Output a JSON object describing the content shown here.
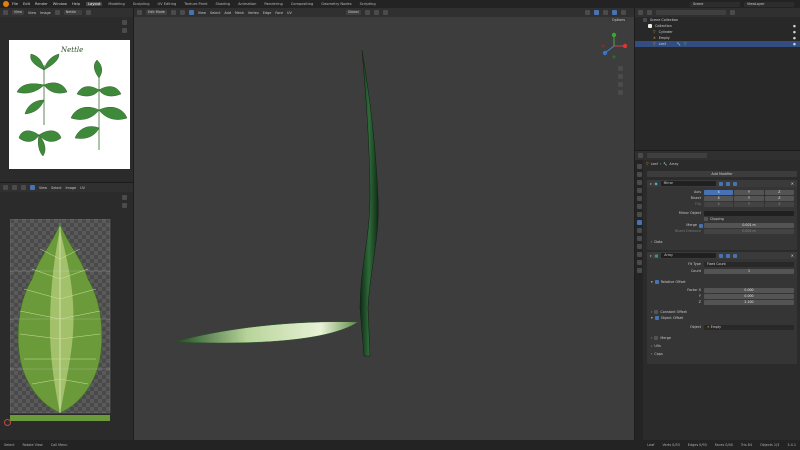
{
  "topbar": {
    "menus": [
      "File",
      "Edit",
      "Render",
      "Window",
      "Help"
    ],
    "workspaces": [
      {
        "label": "Layout",
        "active": true
      },
      {
        "label": "Modeling",
        "active": false
      },
      {
        "label": "Sculpting",
        "active": false
      },
      {
        "label": "UV Editing",
        "active": false
      },
      {
        "label": "Texture Paint",
        "active": false
      },
      {
        "label": "Shading",
        "active": false
      },
      {
        "label": "Animation",
        "active": false
      },
      {
        "label": "Rendering",
        "active": false
      },
      {
        "label": "Compositing",
        "active": false
      },
      {
        "label": "Geometry Nodes",
        "active": false
      },
      {
        "label": "Scripting",
        "active": false
      }
    ],
    "scene": "Scene",
    "view_layer": "ViewLayer"
  },
  "image_editor": {
    "header": [
      "View",
      "View",
      "Image"
    ],
    "image_name": "Nettle",
    "image_title": "Nettle"
  },
  "uv_editor": {
    "header": [
      "View",
      "Select",
      "Image",
      "UV"
    ]
  },
  "viewport": {
    "mode": "Edit Mode",
    "menus": [
      "View",
      "Select",
      "Add",
      "Mesh",
      "Vertex",
      "Edge",
      "Face",
      "UV"
    ],
    "transform": "Global",
    "options": "Options"
  },
  "outliner": {
    "items": [
      {
        "label": "Scene Collection",
        "indent": 0,
        "selected": false,
        "icon": "collection-icon"
      },
      {
        "label": "Collection",
        "indent": 1,
        "selected": false,
        "icon": "collection-icon"
      },
      {
        "label": "Cylinder",
        "indent": 2,
        "selected": false,
        "icon": "mesh-icon"
      },
      {
        "label": "Empty",
        "indent": 2,
        "selected": false,
        "icon": "empty-icon"
      },
      {
        "label": "Leaf",
        "indent": 2,
        "selected": true,
        "icon": "mesh-icon"
      }
    ]
  },
  "properties": {
    "breadcrumb": [
      "Leaf",
      "Array"
    ],
    "add_modifier": "Add Modifier",
    "mirror": {
      "name": "Mirror",
      "axis_label": "Axis",
      "bisect_label": "Bisect",
      "flip_label": "Flip",
      "axes": [
        "X",
        "Y",
        "Z"
      ],
      "mirror_object_label": "Mirror Object",
      "clipping_label": "Clipping",
      "merge_label": "Merge",
      "merge_value": "0.001 m",
      "bisect_distance_label": "Bisect Distance",
      "bisect_distance_value": "0.001 m",
      "data_label": "Data"
    },
    "array": {
      "name": "Array",
      "fit_type_label": "Fit Type",
      "fit_type_value": "Fixed Count",
      "count_label": "Count",
      "count_value": "1",
      "relative_offset_label": "Relative Offset",
      "factor_labels": [
        "Factor X",
        "Y",
        "Z"
      ],
      "factor_values": [
        "0.000",
        "0.000",
        "2.100"
      ],
      "constant_offset_label": "Constant Offset",
      "object_offset_label": "Object Offset",
      "object_label": "Object",
      "object_value": "Empty",
      "merge_label": "Merge",
      "uvs_label": "UVs",
      "caps_label": "Caps"
    }
  },
  "statusbar": {
    "left": [
      "Select",
      "Rotate View",
      "Call Menu"
    ],
    "right": [
      "Leaf",
      "Verts 0/53",
      "Edges 0/93",
      "Faces 0/40",
      "Tris 84",
      "Objects 1/3",
      "3.4.1"
    ]
  },
  "colors": {
    "accent_orange": "#e87d0d",
    "selection_blue": "#4772b3",
    "outliner_selected": "#334d80",
    "viewport_bg": "#3d3d3d"
  }
}
